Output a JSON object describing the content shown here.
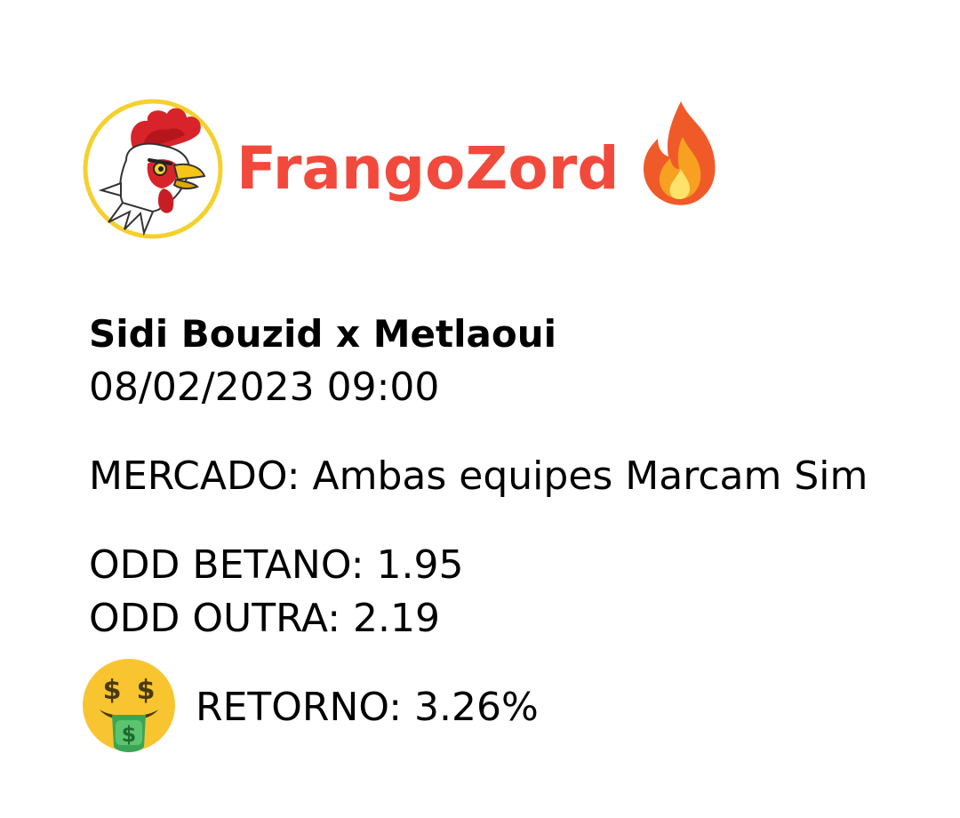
{
  "brand": {
    "name": "FrangoZord",
    "color": "#f14a3c",
    "logo_icon": "rooster-logo-icon",
    "badge_icon": "fire-icon"
  },
  "match": {
    "title": "Sidi Bouzid x Metlaoui",
    "datetime": "08/02/2023 09:00"
  },
  "market": "MERCADO: Ambas equipes Marcam Sim",
  "odds": {
    "betano": "ODD BETANO: 1.95",
    "outra": "ODD OUTRA: 2.19"
  },
  "return": {
    "icon": "money-mouth-face-icon",
    "text": "RETORNO: 3.26%"
  }
}
